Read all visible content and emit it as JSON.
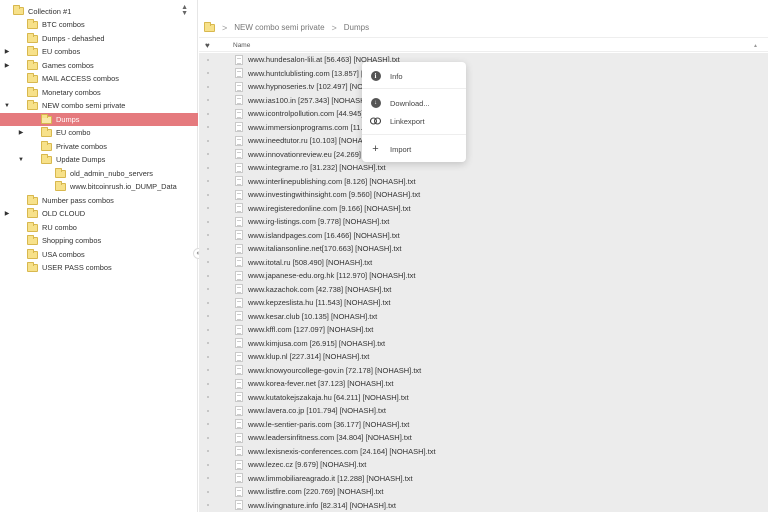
{
  "sidebar": {
    "collection_label": "Collection #1",
    "sort_icon": "sort-icon",
    "items": [
      {
        "label": "BTC combos",
        "expander": ""
      },
      {
        "label": "Dumps - dehashed",
        "expander": ""
      },
      {
        "label": "EU combos",
        "expander": "▶"
      },
      {
        "label": "Games combos",
        "expander": "▶"
      },
      {
        "label": "MAIL ACCESS combos",
        "expander": ""
      },
      {
        "label": "Monetary combos",
        "expander": ""
      },
      {
        "label": "NEW combo semi private",
        "expander": "▼"
      },
      {
        "label": "Dumps",
        "expander": ""
      },
      {
        "label": "EU combo",
        "expander": "▶"
      },
      {
        "label": "Private combos",
        "expander": ""
      },
      {
        "label": "Update Dumps",
        "expander": "▼"
      },
      {
        "label": "old_admin_nubo_servers",
        "expander": ""
      },
      {
        "label": "www.bitcoinrush.io_DUMP_Data",
        "expander": ""
      },
      {
        "label": "Number pass combos",
        "expander": ""
      },
      {
        "label": "OLD CLOUD",
        "expander": "▶"
      },
      {
        "label": "RU combo",
        "expander": ""
      },
      {
        "label": "Shopping combos",
        "expander": ""
      },
      {
        "label": "USA combos",
        "expander": ""
      },
      {
        "label": "USER PASS combos",
        "expander": ""
      }
    ],
    "collapse_label": "«"
  },
  "breadcrumb": {
    "items": [
      "NEW combo semi private",
      "Dumps"
    ],
    "separator": ">"
  },
  "columns": {
    "favorite_icon": "heart-icon",
    "favorite_glyph": "♥",
    "name": "Name",
    "sort_glyph": "▲"
  },
  "files": [
    "www.hundesalon-lili.at [56.463] [NOHASH].txt",
    "www.huntclublisting.com [13.857] [NOHASH].txt",
    "www.hypnoseries.tv [102.497] [NOHASH].txt",
    "www.ias100.in [257.343] [NOHASH].txt",
    "www.icontrolpollution.com [44.945] [NOHASH].txt",
    "www.immersionprograms.com [11.222] [NOHASH].txt",
    "www.ineedtutor.ru [10.103] [NOHASH].txt",
    "www.innovationreview.eu [24.269] [NOHASH].txt",
    "www.integrame.ro [31.232] [NOHASH].txt",
    "www.interlinepublishing.com [8.126] [NOHASH].txt",
    "www.investingwithinsight.com [9.560] [NOHASH].txt",
    "www.iregisteredonline.com [9.166] [NOHASH].txt",
    "www.irg-listings.com [9.778] [NOHASH].txt",
    "www.islandpages.com [16.466] [NOHASH].txt",
    "www.italiansonline.net[170.663] [NOHASH].txt",
    "www.itotal.ru [508.490] [NOHASH].txt",
    "www.japanese-edu.org.hk [112.970] [NOHASH].txt",
    "www.kazachok.com [42.738] [NOHASH].txt",
    "www.kepzeslista.hu [11.543] [NOHASH].txt",
    "www.kesar.club [10.135] [NOHASH].txt",
    "www.kffl.com [127.097] [NOHASH].txt",
    "www.kimjusa.com [26.915] [NOHASH].txt",
    "www.klup.nl [227.314] [NOHASH].txt",
    "www.knowyourcollege-gov.in [72.178] [NOHASH].txt",
    "www.korea-fever.net [37.123] [NOHASH].txt",
    "www.kutatokejszakaja.hu [64.211] [NOHASH].txt",
    "www.lavera.co.jp [101.794] [NOHASH].txt",
    "www.le-sentier-paris.com [36.177] [NOHASH].txt",
    "www.leadersinfitness.com [34.804] [NOHASH].txt",
    "www.lexisnexis-conferences.com [24.164] [NOHASH].txt",
    "www.lezec.cz [9.679] [NOHASH].txt",
    "www.limmobiliareagrado.it [12.288] [NOHASH].txt",
    "www.listfire.com [220.769] [NOHASH].txt",
    "www.livingnature.info [82.314] [NOHASH].txt"
  ],
  "context_menu": {
    "items": [
      {
        "icon": "info-icon",
        "label": "Info"
      },
      {
        "icon": "download-icon",
        "label": "Download..."
      },
      {
        "icon": "link-icon",
        "label": "Linkexport"
      },
      {
        "icon": "plus-icon",
        "label": "Import"
      }
    ]
  },
  "colors": {
    "selected": "#e57a7e",
    "folder": "#f7e18a",
    "list_bg": "#ececec"
  }
}
